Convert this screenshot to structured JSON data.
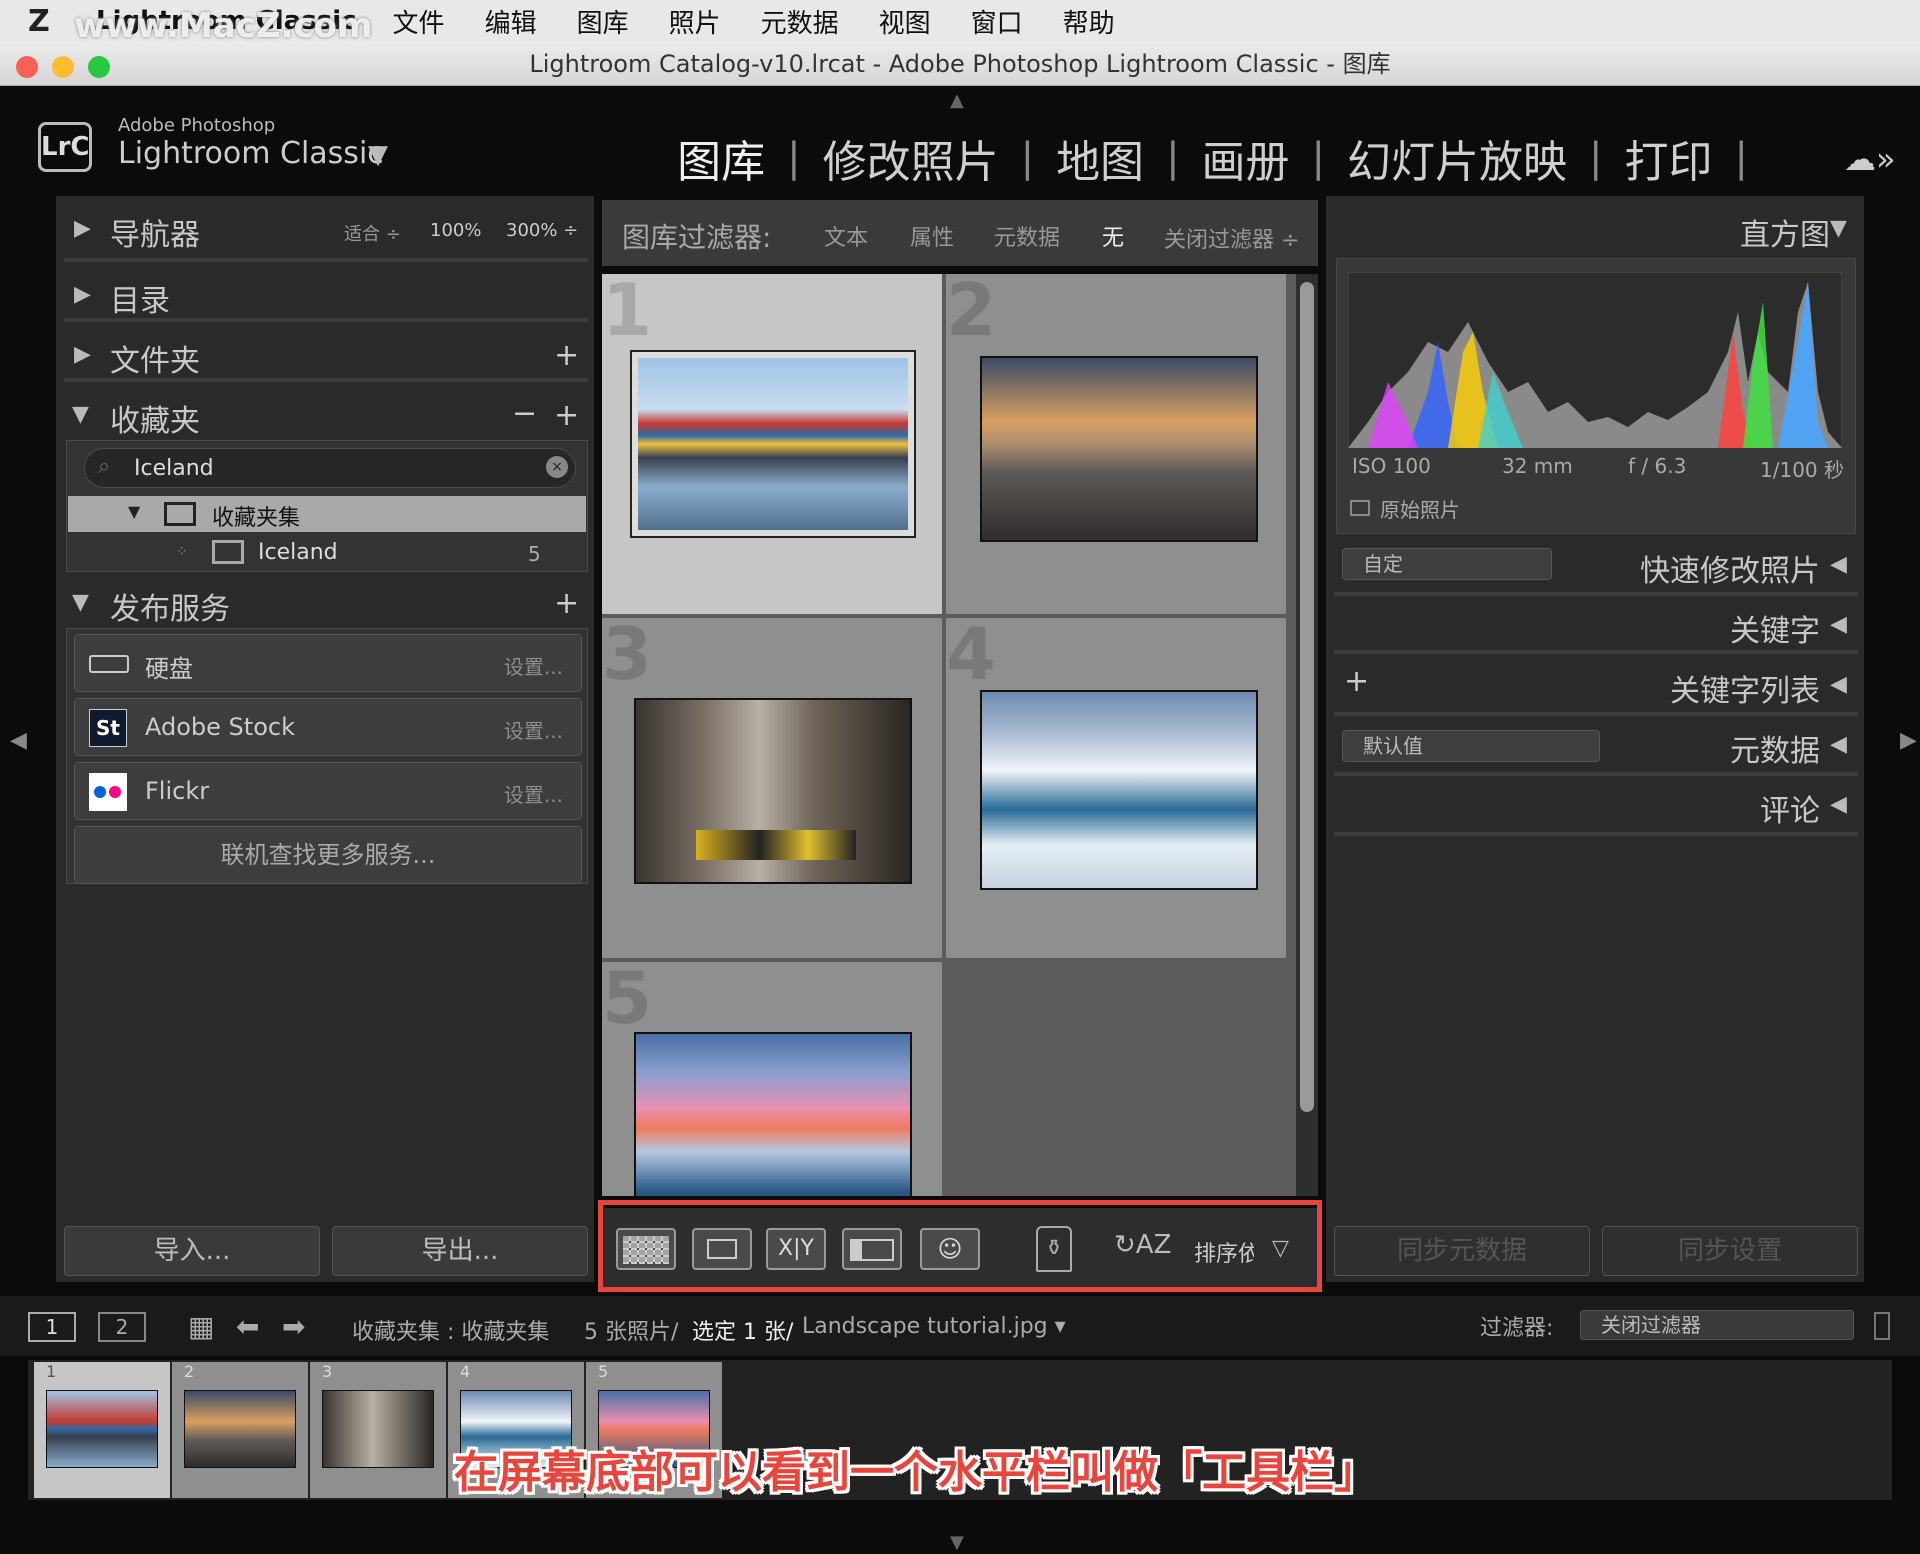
{
  "menubar": {
    "logo": "Z",
    "watermark": "www.MacZ.com",
    "app": "Lightroom Classic",
    "items": [
      "文件",
      "编辑",
      "图库",
      "照片",
      "元数据",
      "视图",
      "窗口",
      "帮助"
    ]
  },
  "window": {
    "title": "Lightroom Catalog-v10.lrcat - Adobe Photoshop Lightroom Classic - 图库"
  },
  "brand": {
    "badge": "LrC",
    "line1": "Adobe Photoshop",
    "line2": "Lightroom Classic",
    "arrow": "▼"
  },
  "modules": [
    "图库",
    "修改照片",
    "地图",
    "画册",
    "幻灯片放映",
    "打印"
  ],
  "left": {
    "navigator": {
      "label": "导航器",
      "zoom": [
        "适合 ÷",
        "100%",
        "300% ÷"
      ]
    },
    "catalog": "目录",
    "folders": "文件夹",
    "collections": {
      "label": "收藏夹",
      "search": "Iceland",
      "set": "收藏夹集",
      "child": "Iceland",
      "child_count": "5"
    },
    "publish": {
      "label": "发布服务",
      "services": [
        {
          "name": "硬盘",
          "setup": "设置..."
        },
        {
          "name": "Adobe Stock",
          "setup": "设置..."
        },
        {
          "name": "Flickr",
          "setup": "设置..."
        }
      ],
      "more": "联机查找更多服务..."
    },
    "import": "导入...",
    "export": "导出..."
  },
  "filterbar": {
    "label": "图库过滤器:",
    "items": [
      "文本",
      "属性",
      "元数据",
      "无"
    ],
    "close": "关闭过滤器 ÷"
  },
  "grid": {
    "cells": [
      "1",
      "2",
      "3",
      "4",
      "5"
    ],
    "selected": 1
  },
  "toolbar": {
    "sort": "排序依"
  },
  "right": {
    "histogram": "直方图",
    "info": {
      "iso": "ISO 100",
      "focal": "32 mm",
      "aperture": "f / 6.3",
      "shutter": "1/100 秒"
    },
    "original": "原始照片",
    "preset": "自定",
    "quick": "快速修改照片",
    "keywording": "关键字",
    "keywordlist": "关键字列表",
    "metadata_preset": "默认值",
    "metadata": "元数据",
    "comments": "评论",
    "sync_meta": "同步元数据",
    "sync_settings": "同步设置"
  },
  "filmbar": {
    "screen1": "1",
    "screen2": "2",
    "source": "收藏夹集 : 收藏夹集",
    "count": "5 张照片/",
    "selected": "选定 1 张/",
    "file": "Landscape tutorial.jpg ▾",
    "filter_label": "过滤器:",
    "filter_value": "关闭过滤器"
  },
  "filmstrip": [
    "1",
    "2",
    "3",
    "4",
    "5"
  ],
  "caption": "在屏幕底部可以看到一个水平栏叫做「工具栏」",
  "colors": {
    "highlight": "#e8453c"
  }
}
